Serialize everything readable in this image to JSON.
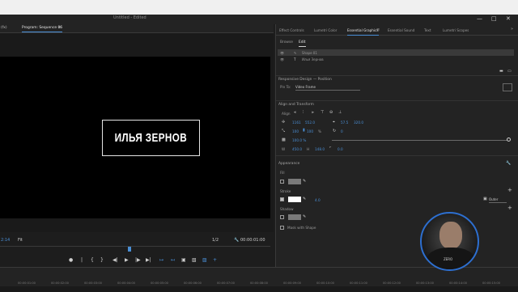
{
  "window": {
    "title": "Untitled - Edited",
    "controls": [
      "—",
      "□",
      "✕"
    ]
  },
  "program": {
    "tabs": [
      {
        "label": "(fx)"
      },
      {
        "label": "Program: Sequence 06"
      },
      {
        "label": "≡"
      }
    ],
    "title_text": "ИЛЬЯ ЗЕРНОВ",
    "timecode_left": "2:14",
    "fit": "Fit",
    "quality": "1/2",
    "timecode_right": "00:00:01:00",
    "controls": [
      "●",
      "|",
      "{",
      "}",
      "|◀",
      "◀|",
      "▶",
      "|▶",
      "▶|",
      "↦",
      "↤",
      "▣",
      "▧",
      "▨",
      "+"
    ]
  },
  "timeline": {
    "ticks": [
      "00:00:01:00",
      "00:00:02:00",
      "00:00:03:00",
      "00:00:04:00",
      "00:00:05:00",
      "00:00:06:00",
      "00:00:07:00",
      "00:00:08:00",
      "00:00:09:00",
      "00:00:10:00",
      "00:00:11:00",
      "00:00:12:00",
      "00:00:13:00",
      "00:00:14:00",
      "00:00:15:00"
    ]
  },
  "panel": {
    "tabs": [
      {
        "label": "Effect Controls"
      },
      {
        "label": "Lumetri Color"
      },
      {
        "label": "Essential Graphics"
      },
      {
        "label": "Essential Sound"
      },
      {
        "label": "Text"
      },
      {
        "label": "Lumetri Scopes"
      }
    ],
    "subtabs": [
      {
        "label": "Browse"
      },
      {
        "label": "Edit"
      }
    ],
    "layers": [
      {
        "name": "Shape 01"
      },
      {
        "name": "Илья Зернов"
      }
    ],
    "responsive": {
      "heading": "Responsive Design — Position",
      "pin_label": "Pin To:",
      "pin_value": "Video Frame"
    },
    "align": {
      "heading": "Align and Transform",
      "align_label": "Align",
      "pos_x": "1161",
      "pos_y": "552.0",
      "anchor_x": "57.5",
      "anchor_y": "320.0",
      "scale_w": "100",
      "scale_h": "100",
      "scale_pct": "%",
      "rotation": "0",
      "opacity": "100.0 %",
      "width": "450.0",
      "height": "148.0",
      "corner": "0.0"
    },
    "appearance": {
      "heading": "Appearance",
      "fill_label": "Fill",
      "fill_color": "#7a7a7a",
      "stroke_label": "Stroke",
      "stroke_color": "#ffffff",
      "stroke_width": "4.0",
      "stroke_type": "Outer",
      "shadow_label": "Shadow",
      "shadow_color": "#7a7a7a",
      "mask_label": "Mask with Shape"
    }
  }
}
